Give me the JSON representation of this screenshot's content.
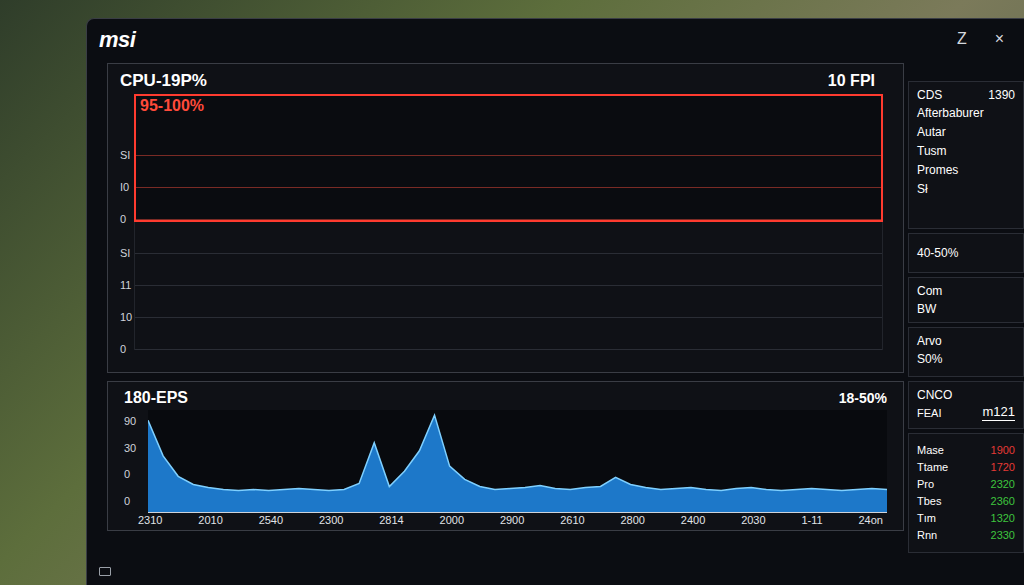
{
  "window": {
    "logo": "msi",
    "buttons": [
      "Z",
      "×"
    ]
  },
  "cpu_chart": {
    "title": "CPU-19P%",
    "reading": "10 FPI",
    "band": {
      "label": "95-100%",
      "ticks": [
        "SI",
        "I0",
        "0"
      ]
    },
    "ticks": [
      "SI",
      "11",
      "10",
      "0"
    ]
  },
  "fps_chart": {
    "title": "180-EPS",
    "reading": "18-50%",
    "y_ticks": [
      "90",
      "30",
      "0",
      "0"
    ],
    "x_ticks": [
      "2310",
      "2010",
      "2540",
      "2300",
      "2814",
      "2000",
      "2900",
      "2610",
      "2800",
      "2400",
      "2030",
      "1-11",
      "24on"
    ],
    "series": [
      {
        "values": [
          90,
          55,
          35,
          27,
          24,
          22,
          21,
          22,
          21,
          22,
          23,
          22,
          21,
          22,
          28,
          68,
          25,
          40,
          60,
          95,
          45,
          32,
          25,
          22,
          23,
          24,
          26,
          23,
          22,
          24,
          25,
          34,
          27,
          24,
          22,
          23,
          24,
          22,
          21,
          23,
          24,
          22,
          21,
          22,
          23,
          22,
          21,
          22,
          23,
          22
        ]
      }
    ]
  },
  "sidebar": {
    "header": {
      "label": "CDS",
      "value": "1390"
    },
    "items": [
      "Afterbaburer",
      "Autar",
      "Tusm",
      "Promes",
      "Sł"
    ],
    "usage": "40-50%",
    "com": {
      "label": "Com",
      "value": "BW"
    },
    "arvo": {
      "label": "Arvo",
      "value": "S0%"
    },
    "cnco": {
      "title": "CNCO",
      "label": "FEAI",
      "value": "m121"
    },
    "clocks": [
      {
        "label": "Mase",
        "value": "1900",
        "color": "#e53935"
      },
      {
        "label": "Ttame",
        "value": "1720",
        "color": "#e53935"
      },
      {
        "label": "Pro",
        "value": "2320",
        "color": "#3ec43e"
      },
      {
        "label": "Tbes",
        "value": "2360",
        "color": "#3ec43e"
      },
      {
        "label": "Tım",
        "value": "1320",
        "color": "#3ec43e"
      },
      {
        "label": "Rnn",
        "value": "2330",
        "color": "#3ec43e"
      }
    ]
  }
}
